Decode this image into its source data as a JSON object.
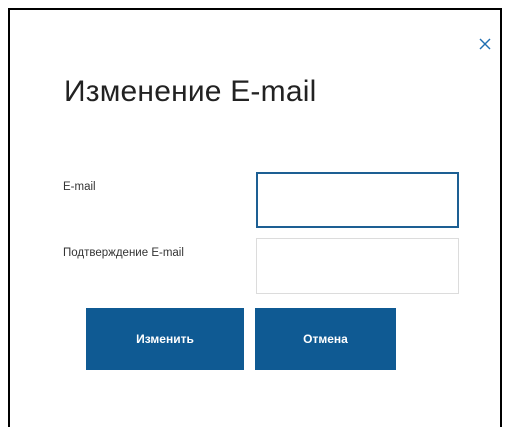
{
  "dialog": {
    "title": "Изменение E-mail",
    "close_icon": "close-icon",
    "fields": {
      "email": {
        "label": "E-mail",
        "value": "",
        "placeholder": ""
      },
      "confirm_email": {
        "label": "Подтверждение E-mail",
        "value": "",
        "placeholder": ""
      }
    },
    "buttons": {
      "submit_label": "Изменить",
      "cancel_label": "Отмена"
    }
  },
  "colors": {
    "accent": "#0f5a93",
    "close_icon": "#1f6fb2",
    "focused_border": "#1d5f93",
    "input_border": "#dcdcdc",
    "frame_border": "#000000"
  }
}
